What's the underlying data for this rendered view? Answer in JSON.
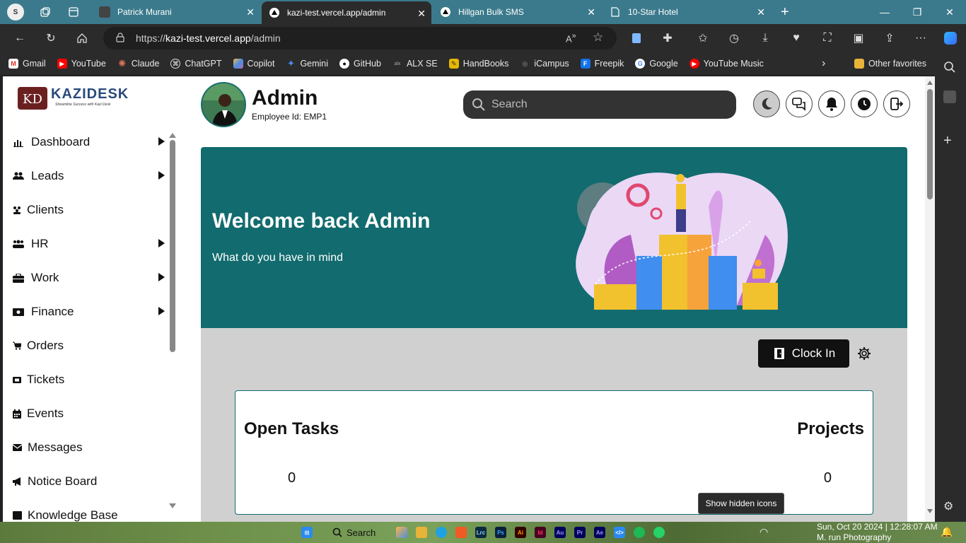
{
  "tabs": [
    {
      "label": "Patrick Murani",
      "active": false
    },
    {
      "label": "kazi-test.vercel.app/admin",
      "active": true
    },
    {
      "label": "Hillgan Bulk SMS",
      "active": false
    },
    {
      "label": "10-Star Hotel",
      "active": false
    }
  ],
  "url": {
    "prefix": "https://",
    "host": "kazi-test.vercel.app",
    "path": "/admin"
  },
  "bookmarks": [
    "Gmail",
    "YouTube",
    "Claude",
    "ChatGPT",
    "Copilot",
    "Gemini",
    "GitHub",
    "ALX SE",
    "HandBooks",
    "iCampus",
    "Freepik",
    "Google",
    "YouTube Music"
  ],
  "other_favorites": "Other favorites",
  "brand": {
    "name": "KAZIDESK",
    "tagline": "Streamline Success with Kazi Desk",
    "accent": "#126b6e"
  },
  "sidebar": {
    "items": [
      {
        "label": "Dashboard",
        "icon": "bar-chart-icon",
        "expandable": true
      },
      {
        "label": "Leads",
        "icon": "users-icon",
        "expandable": true
      },
      {
        "label": "Clients",
        "icon": "clients-icon",
        "expandable": false
      },
      {
        "label": "HR",
        "icon": "team-icon",
        "expandable": true
      },
      {
        "label": "Work",
        "icon": "briefcase-icon",
        "expandable": true
      },
      {
        "label": "Finance",
        "icon": "money-icon",
        "expandable": true
      },
      {
        "label": "Orders",
        "icon": "cart-icon",
        "expandable": false
      },
      {
        "label": "Tickets",
        "icon": "ticket-icon",
        "expandable": false
      },
      {
        "label": "Events",
        "icon": "calendar-icon",
        "expandable": false
      },
      {
        "label": "Messages",
        "icon": "envelope-icon",
        "expandable": false
      },
      {
        "label": "Notice Board",
        "icon": "megaphone-icon",
        "expandable": false
      },
      {
        "label": "Knowledge Base",
        "icon": "book-icon",
        "expandable": false
      }
    ]
  },
  "header": {
    "name": "Admin",
    "employee_id": "Employee Id: EMP1",
    "search_placeholder": "Search"
  },
  "banner": {
    "title": "Welcome back Admin",
    "subtitle": "What do you have in mind"
  },
  "clock_in": "Clock In",
  "stats": {
    "open_tasks": {
      "label": "Open Tasks",
      "value": "0"
    },
    "projects": {
      "label": "Projects",
      "value": "0"
    }
  },
  "tooltip": "Show hidden icons",
  "taskbar": {
    "search": "Search",
    "datetime": "Sun, Oct 20 2024 | 12:28:07 AM",
    "credit": "M. run Photography"
  }
}
